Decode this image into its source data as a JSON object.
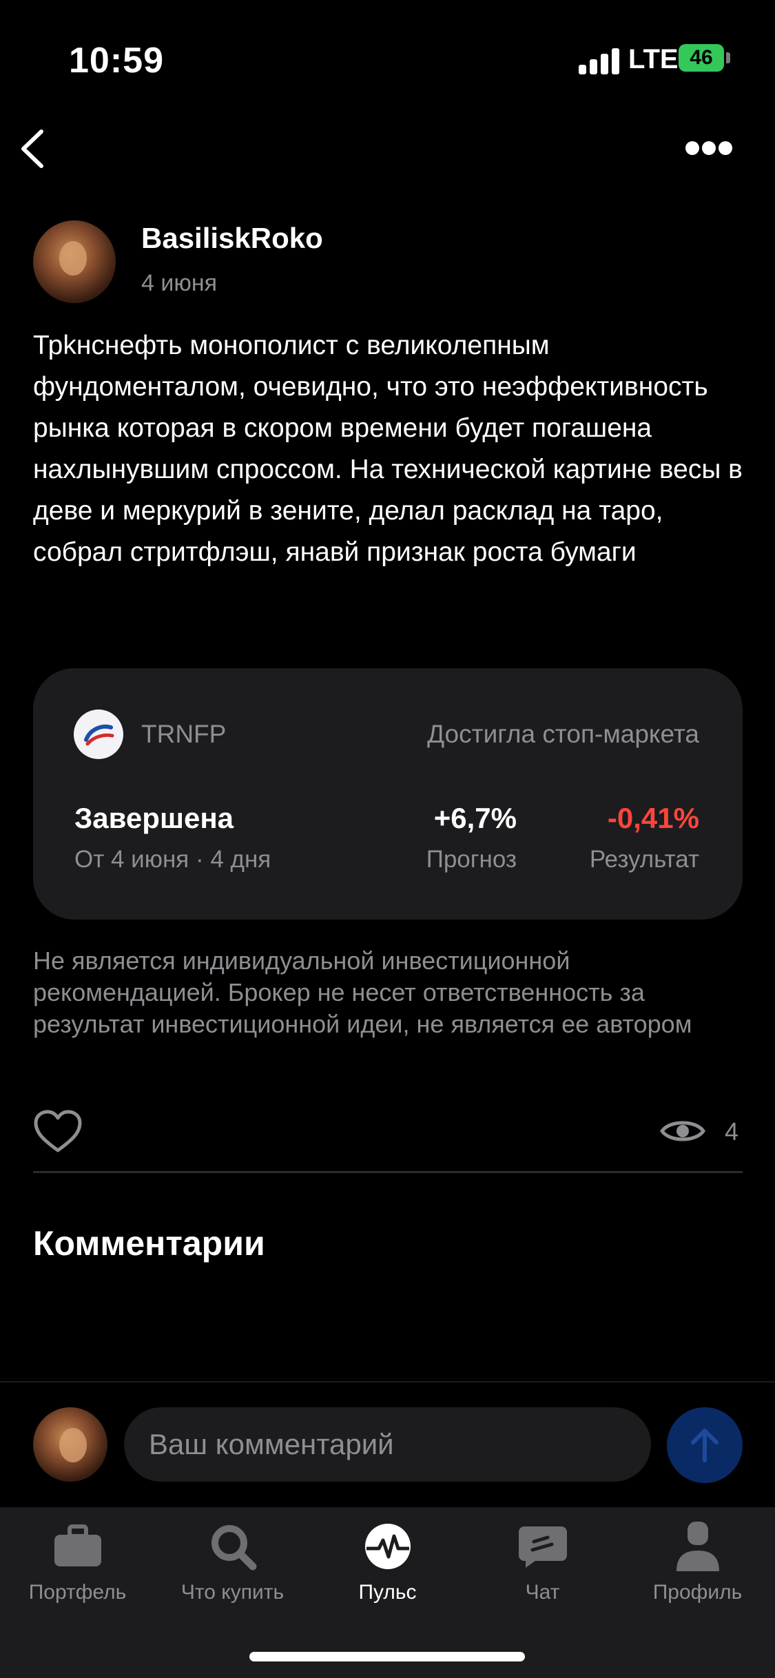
{
  "status_bar": {
    "time": "10:59",
    "network": "LTE",
    "battery": "46"
  },
  "nav": {
    "back_icon": "chevron-left-icon",
    "more_icon": "ellipsis-icon"
  },
  "post": {
    "author": "BasiliskRoko",
    "date": "4 июня",
    "text": "Трkнснефть монополист с великолепным фундоменталом, очевидно, что это неэффективность рынка которая в скором времени будет погашена нахлынувшим спроссом. На технической картине весы в деве и меркурий в зените, делал расклад на таро, собрал стритфлэш, янавй признак роста бумаги"
  },
  "idea_card": {
    "ticker": "TRNFP",
    "status": "Достигла стоп-маркета",
    "state": "Завершена",
    "period": "От 4 июня · 4 дня",
    "forecast_value": "+6,7%",
    "forecast_label": "Прогноз",
    "result_value": "-0,41%",
    "result_label": "Результат",
    "result_color": "#ff453a"
  },
  "disclaimer": "Не является индивидуальной инвестиционной рекомендацией. Брокер не несет ответственность за результат инвестиционной идеи, не является ее автором",
  "reactions": {
    "like_icon": "heart-icon",
    "views_icon": "eye-icon",
    "views": "4"
  },
  "comments": {
    "title": "Комментарии",
    "input_placeholder": "Ваш комментарий",
    "send_icon": "arrow-up-icon"
  },
  "tabbar": {
    "tabs": [
      {
        "label": "Портфель",
        "icon": "briefcase-icon"
      },
      {
        "label": "Что купить",
        "icon": "search-icon"
      },
      {
        "label": "Пульс",
        "icon": "pulse-icon",
        "active": true
      },
      {
        "label": "Чат",
        "icon": "chat-icon"
      },
      {
        "label": "Профиль",
        "icon": "profile-icon"
      }
    ]
  }
}
